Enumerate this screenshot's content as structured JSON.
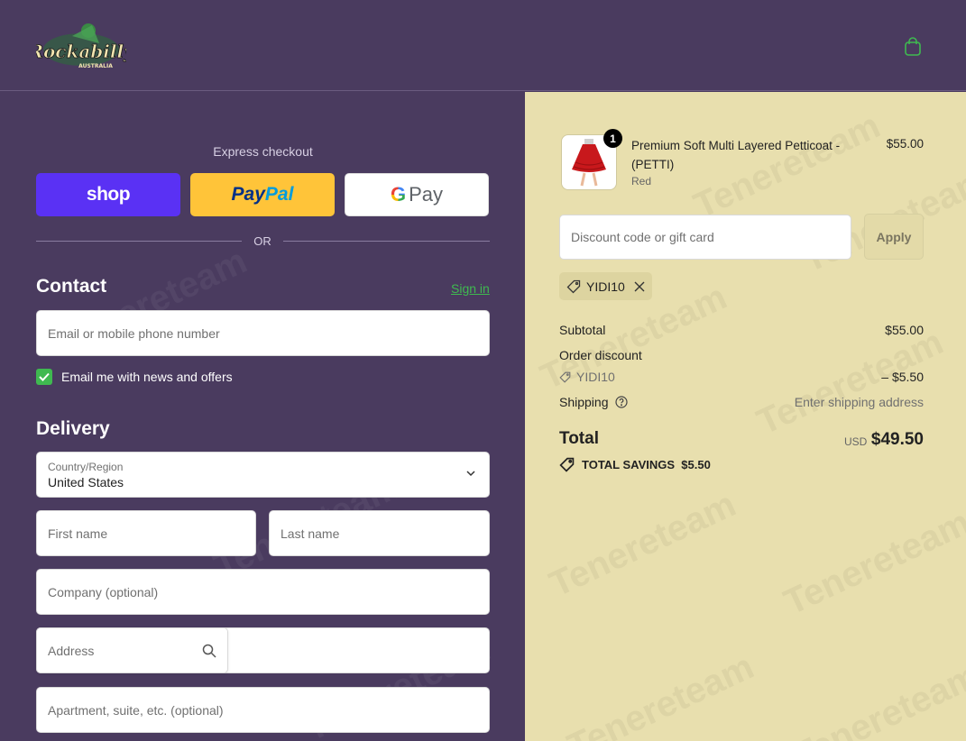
{
  "header": {
    "logo_text": "Rockabilly",
    "logo_subtext": "AUSTRALIA",
    "cart_icon": "shopping-bag-icon"
  },
  "express": {
    "title": "Express checkout",
    "shop_label": "shop",
    "paypal_pay": "Pay",
    "paypal_pal": "Pal",
    "gpay_g": "G",
    "gpay_label": "Pay",
    "or_text": "OR"
  },
  "contact": {
    "title": "Contact",
    "sign_in": "Sign in",
    "email_placeholder": "Email or mobile phone number",
    "newsletter_label": "Email me with news and offers",
    "newsletter_checked": true
  },
  "delivery": {
    "title": "Delivery",
    "country_label": "Country/Region",
    "country_value": "United States",
    "first_name": "First name",
    "last_name": "Last name",
    "company": "Company (optional)",
    "address": "Address",
    "apartment": "Apartment, suite, etc. (optional)"
  },
  "summary": {
    "product": {
      "name": "Premium Soft Multi Layered Petticoat - (PETTI)",
      "variant": "Red",
      "price": "$55.00",
      "quantity": "1"
    },
    "discount_placeholder": "Discount code or gift card",
    "apply_label": "Apply",
    "applied_code": "YIDI10",
    "subtotal_label": "Subtotal",
    "subtotal_value": "$55.00",
    "order_discount_label": "Order discount",
    "discount_code": "YIDI10",
    "discount_value": "– $5.50",
    "shipping_label": "Shipping",
    "shipping_value": "Enter shipping address",
    "total_label": "Total",
    "total_currency": "USD",
    "total_value": "$49.50",
    "savings_label": "TOTAL SAVINGS",
    "savings_value": "$5.50"
  },
  "watermark": "Tenereteam",
  "colors": {
    "left_bg": "#4a3b5f",
    "right_bg": "#e8dfae",
    "accent_green": "#3fb950",
    "shop_purple": "#5a31f4",
    "paypal_yellow": "#ffc439"
  }
}
